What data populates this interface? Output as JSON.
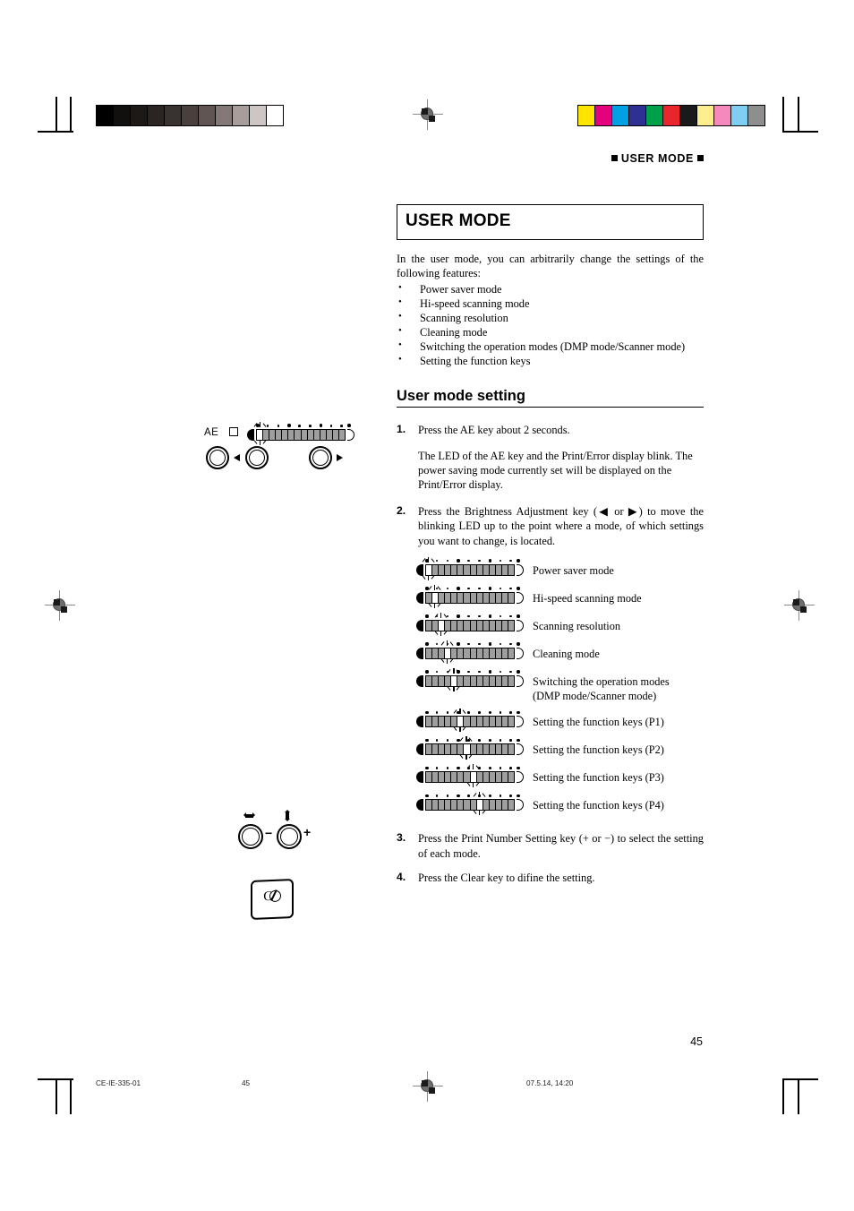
{
  "running_head": "USER MODE",
  "title": "USER MODE",
  "intro": "In the user mode, you can arbitrarily change the settings of the following features:",
  "features": [
    "Power saver mode",
    "Hi-speed scanning mode",
    "Scanning resolution",
    "Cleaning mode",
    "Switching the operation modes (DMP mode/Scanner mode)",
    "Setting the function keys"
  ],
  "section_heading": "User mode setting",
  "steps": [
    {
      "num": "1.",
      "paragraphs": [
        "Press the AE key about 2 seconds.",
        "The LED of the AE key and the Print/Error display blink. The power saving mode currently set will be displayed on the Print/Error display."
      ]
    },
    {
      "num": "2.",
      "paragraphs": [
        "Press the Brightness Adjustment key (◀ or ▶) to move the blinking LED up to the point where a mode, of which settings you want to change, is located."
      ]
    },
    {
      "num": "3.",
      "paragraphs": [
        "Press the Print Number Setting key (+ or −) to select the setting of each mode."
      ]
    },
    {
      "num": "4.",
      "paragraphs": [
        "Press the Clear key to difine the setting."
      ]
    }
  ],
  "gauges": {
    "segments": 14,
    "rows": [
      {
        "blink_index": 0,
        "label": "Power saver mode"
      },
      {
        "blink_index": 1,
        "label": "Hi-speed scanning mode"
      },
      {
        "blink_index": 2,
        "label": "Scanning resolution"
      },
      {
        "blink_index": 3,
        "label": "Cleaning mode"
      },
      {
        "blink_index": 4,
        "label": "Switching the operation modes\n(DMP mode/Scanner mode)"
      },
      {
        "blink_index": 5,
        "label": "Setting the function keys (P1)"
      },
      {
        "blink_index": 6,
        "label": "Setting the function keys (P2)"
      },
      {
        "blink_index": 7,
        "label": "Setting the function keys (P3)"
      },
      {
        "blink_index": 8,
        "label": "Setting the function keys (P4)"
      }
    ]
  },
  "illustrations": {
    "ae_panel": {
      "ae_label": "AE",
      "gauge_blink_index": 0,
      "left_arrow": "◀",
      "right_arrow": "▶"
    },
    "print_number_panel": {
      "minus_label": "−",
      "plus_label": "+"
    },
    "clear_key": {
      "label": "C"
    }
  },
  "page_number": "45",
  "footer": {
    "doc_code": "CE-IE-335-01",
    "page": "45",
    "timestamp": "07.5.14, 14:20"
  },
  "color_bars": {
    "grayscale": [
      "#000000",
      "#120f0f",
      "#1d1917",
      "#2a2422",
      "#3a3230",
      "#49403d",
      "#5f5451",
      "#837876",
      "#a79d9b",
      "#cec6c4",
      "#ffffff"
    ],
    "color": [
      "#ffe400",
      "#e5007e",
      "#00a0e2",
      "#2e3191",
      "#00a04a",
      "#e8252a",
      "#1a1a1a",
      "#fcee8c",
      "#f489bd",
      "#7ecdf2",
      "#8e8e8e"
    ]
  }
}
